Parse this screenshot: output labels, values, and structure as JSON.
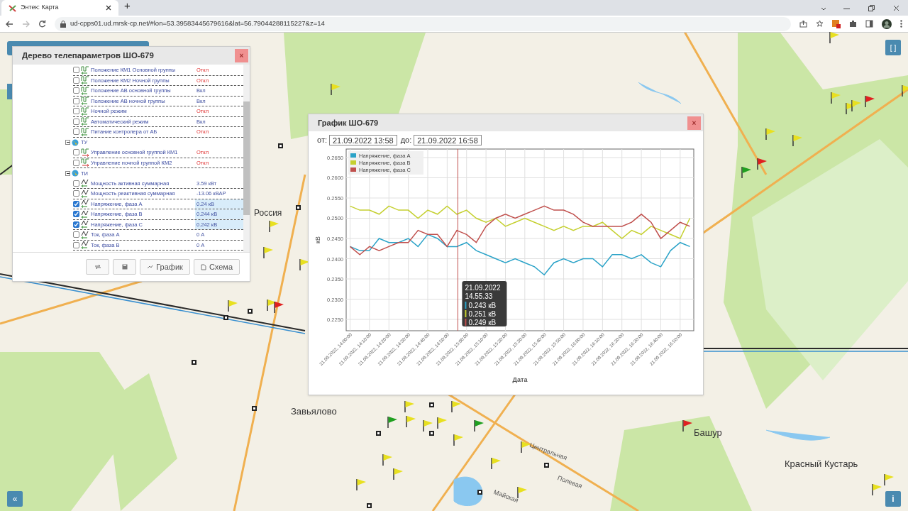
{
  "browser": {
    "tab_title": "Энтек: Карта",
    "new_tab": "+",
    "url": "ud-cpps01.ud.mrsk-cp.net/#lon=53.39583445679616&lat=56.79044288115227&z=14"
  },
  "map": {
    "labels": [
      {
        "text": "Россия",
        "kind": "place"
      },
      {
        "text": "Завьялово",
        "kind": "place"
      },
      {
        "text": "Башур",
        "kind": "place"
      },
      {
        "text": "Красный Кустарь",
        "kind": "place"
      },
      {
        "text": "Центральная",
        "kind": "street"
      },
      {
        "text": "Полевая",
        "kind": "street"
      },
      {
        "text": "Майская",
        "kind": "street"
      }
    ],
    "markers": [
      {
        "color": "#e8e020"
      },
      {
        "color": "#e8e020"
      },
      {
        "color": "#e8e020"
      },
      {
        "color": "#e8e020"
      },
      {
        "color": "#e8e020"
      },
      {
        "color": "#e8e020"
      },
      {
        "color": "#e8e020"
      },
      {
        "color": "#e8e020"
      },
      {
        "color": "#e8e020"
      },
      {
        "color": "#e8e020"
      },
      {
        "color": "#e8e020"
      },
      {
        "color": "#e8e020"
      },
      {
        "color": "#e8e020"
      },
      {
        "color": "#e8e020"
      },
      {
        "color": "#e8e020"
      },
      {
        "color": "#e8e020"
      },
      {
        "color": "#e8e020"
      },
      {
        "color": "#e8e020"
      },
      {
        "color": "#e8e020"
      },
      {
        "color": "#e8e020"
      },
      {
        "color": "#e8e020"
      },
      {
        "color": "#e8e020"
      },
      {
        "color": "#e8e020"
      },
      {
        "color": "#e8e020"
      },
      {
        "color": "#e8e020"
      },
      {
        "color": "#e8e020"
      },
      {
        "color": "#e8e020"
      },
      {
        "color": "#e02020"
      },
      {
        "color": "#e02020"
      },
      {
        "color": "#e02020"
      },
      {
        "color": "#e02020"
      },
      {
        "color": "#20a020"
      },
      {
        "color": "#20a020"
      },
      {
        "color": "#20a020"
      }
    ]
  },
  "tree_window": {
    "title": "Дерево телепараметров ШО-679",
    "close": "×",
    "items": [
      {
        "kind": "signal",
        "label": "Положение КМ1 Основной группы",
        "value": "Откл",
        "on": false,
        "checked": false
      },
      {
        "kind": "signal",
        "label": "Положение КМ2 Ночной группы",
        "value": "Откл",
        "on": false,
        "checked": false
      },
      {
        "kind": "signal",
        "label": "Положение АВ основной группы",
        "value": "Вкл",
        "on": true,
        "checked": false
      },
      {
        "kind": "signal",
        "label": "Положение АВ ночной группы",
        "value": "Вкл",
        "on": true,
        "checked": false
      },
      {
        "kind": "signal",
        "label": "Ночной режим",
        "value": "Откл",
        "on": false,
        "checked": false
      },
      {
        "kind": "signal",
        "label": "Автоматический режим",
        "value": "Вкл",
        "on": true,
        "checked": false
      },
      {
        "kind": "signal",
        "label": "Питание контролера от АБ",
        "value": "Откл",
        "on": false,
        "checked": false
      },
      {
        "kind": "group",
        "label": "ТУ",
        "expanded": true,
        "children": [
          {
            "kind": "command",
            "label": "Управление основной группой КМ1",
            "value": "Откл",
            "on": false,
            "checked": false
          },
          {
            "kind": "command",
            "label": "Управление ночной группой КМ2",
            "value": "Откл",
            "on": false,
            "checked": false
          }
        ]
      },
      {
        "kind": "group",
        "label": "ТИ",
        "expanded": true,
        "children": [
          {
            "kind": "measure",
            "label": "Мощность активная суммарная",
            "value": "3.59 кВт",
            "on": true,
            "checked": false
          },
          {
            "kind": "measure",
            "label": "Мощность реактивная суммарная",
            "value": "-13.06 кВАР",
            "on": true,
            "checked": false
          },
          {
            "kind": "measure",
            "label": "Напряжение, фаза A",
            "value": "0.24 кВ",
            "on": true,
            "checked": true
          },
          {
            "kind": "measure",
            "label": "Напряжение, фаза B",
            "value": "0.244 кВ",
            "on": true,
            "checked": true
          },
          {
            "kind": "measure",
            "label": "Напряжение, фаза C",
            "value": "0.242 кВ",
            "on": true,
            "checked": true
          },
          {
            "kind": "measure",
            "label": "Ток, фаза A",
            "value": "0 А",
            "on": true,
            "checked": false
          },
          {
            "kind": "measure",
            "label": "Ток, фаза B",
            "value": "0 А",
            "on": true,
            "checked": false
          }
        ]
      }
    ],
    "buttons": [
      {
        "kind": "swap"
      },
      {
        "kind": "save"
      },
      {
        "kind": "chart",
        "label": "График"
      },
      {
        "kind": "scheme",
        "label": "Схема"
      }
    ]
  },
  "chart_window": {
    "title": "График ШО-679",
    "close": "×",
    "from_label": "от:",
    "from_value": "21.09.2022 13:58",
    "to_label": "до:",
    "to_value": "21.09.2022 16:58",
    "tooltip": {
      "date": "21.09.2022",
      "time": "14.55.33",
      "values": [
        "0.243 кВ",
        "0.251 кВ",
        "0.249 кВ"
      ]
    },
    "chart_data": {
      "type": "line",
      "xlabel": "Дата",
      "ylabel": "кВ",
      "grid": true,
      "legend": true,
      "ylim": [
        0.2222,
        0.2671
      ],
      "categories": [
        "21.09.2022, 14:00:00",
        null,
        "21.09.2022, 14:10:00",
        null,
        "21.09.2022, 14:20:00",
        null,
        "21.09.2022, 14:30:00",
        null,
        "21.09.2022, 14:40:00",
        null,
        "21.09.2022, 14:50:00",
        null,
        "21.09.2022, 15:00:00",
        null,
        "21.09.2022, 15:10:00",
        null,
        "21.09.2022, 15:20:00",
        null,
        "21.09.2022, 15:30:00",
        null,
        "21.09.2022, 15:40:00",
        null,
        "21.09.2022, 15:50:00",
        null,
        "21.09.2022, 16:00:00",
        null,
        "21.09.2022, 16:10:00",
        null,
        "21.09.2022, 16:20:00",
        null,
        "21.09.2022, 16:30:00",
        null,
        "21.09.2022, 16:40:00",
        null,
        "21.09.2022, 16:50:00",
        null
      ],
      "yticks": [
        {
          "value": 0.225,
          "label": "0.2250"
        },
        {
          "value": 0.23,
          "label": "0.2300"
        },
        {
          "value": 0.235,
          "label": "0.2350"
        },
        {
          "value": 0.24,
          "label": "0.2400"
        },
        {
          "value": 0.245,
          "label": "0.2450"
        },
        {
          "value": 0.25,
          "label": "0.2500"
        },
        {
          "value": 0.255,
          "label": "0.2550"
        },
        {
          "value": 0.26,
          "label": "0.2600"
        },
        {
          "value": 0.265,
          "label": "0.2650"
        }
      ],
      "series": [
        {
          "name": "Напряжение, фаза A",
          "color": "#2ba3c8",
          "values": [
            0.243,
            0.242,
            0.242,
            0.245,
            0.244,
            0.244,
            0.245,
            0.243,
            0.246,
            0.245,
            0.243,
            0.243,
            0.244,
            0.242,
            0.241,
            0.24,
            0.239,
            0.24,
            0.239,
            0.238,
            0.236,
            0.239,
            0.24,
            0.239,
            0.24,
            0.24,
            0.238,
            0.241,
            0.241,
            0.24,
            0.241,
            0.239,
            0.238,
            0.242,
            0.244,
            0.243
          ]
        },
        {
          "name": "Напряжение, фаза B",
          "color": "#c5d030",
          "values": [
            0.253,
            0.252,
            0.252,
            0.251,
            0.253,
            0.252,
            0.252,
            0.25,
            0.252,
            0.251,
            0.253,
            0.251,
            0.252,
            0.25,
            0.249,
            0.25,
            0.248,
            0.249,
            0.25,
            0.249,
            0.248,
            0.247,
            0.248,
            0.247,
            0.248,
            0.248,
            0.249,
            0.247,
            0.245,
            0.247,
            0.246,
            0.248,
            0.247,
            0.246,
            0.245,
            0.25
          ]
        },
        {
          "name": "Напряжение, фаза C",
          "color": "#c0504d",
          "values": [
            0.243,
            0.241,
            0.243,
            0.242,
            0.243,
            0.244,
            0.244,
            0.247,
            0.246,
            0.246,
            0.243,
            0.247,
            0.246,
            0.244,
            0.248,
            0.25,
            0.251,
            0.25,
            0.251,
            0.252,
            0.253,
            0.252,
            0.252,
            0.251,
            0.249,
            0.248,
            0.248,
            0.248,
            0.248,
            0.249,
            0.251,
            0.249,
            0.245,
            0.247,
            0.249,
            0.248
          ]
        }
      ]
    }
  },
  "map_controls": {
    "fullscreen": "[ ]",
    "collapse": "«",
    "info": "i"
  }
}
